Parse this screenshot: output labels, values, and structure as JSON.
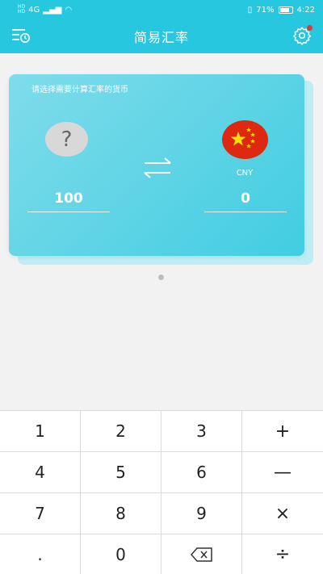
{
  "status_bar": {
    "left_tags": [
      "HD",
      "HD"
    ],
    "signal_text": "4G",
    "battery": "71%",
    "time": "4:22"
  },
  "header": {
    "title": "简易汇率",
    "left_icon": "history-clock-icon",
    "right_icon": "gear-icon"
  },
  "converter": {
    "hint": "请选择需要计算汇率的货币",
    "from": {
      "flag": "?",
      "amount": "100"
    },
    "to": {
      "currency": "CNY",
      "amount": "0"
    },
    "swap_icon": "swap-arrows-icon"
  },
  "keypad": {
    "keys": [
      "1",
      "2",
      "3",
      "+",
      "4",
      "5",
      "6",
      "—",
      "7",
      "8",
      "9",
      "×",
      ".",
      "0",
      "⌫",
      "÷"
    ]
  },
  "colors": {
    "primary": "#27c8df",
    "card_start": "#7fdcea",
    "card_end": "#41cde2",
    "china_red": "#de2910",
    "china_yellow": "#ffde00"
  }
}
